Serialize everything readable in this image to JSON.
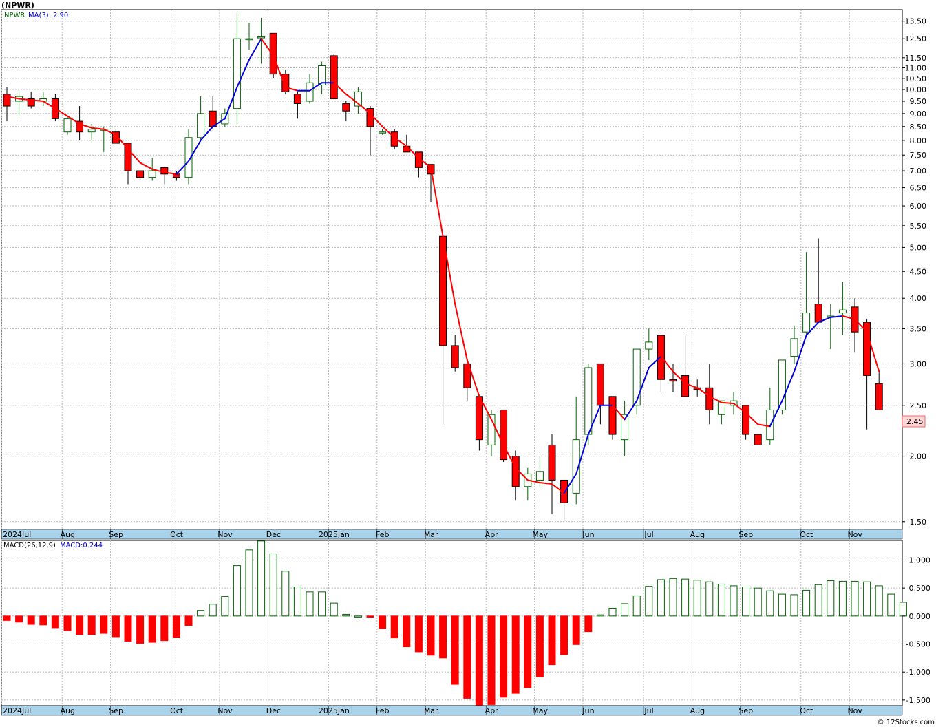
{
  "title": "(NPWR)",
  "footer": "© 12Stocks.com",
  "price_panel": {
    "legend_symbol": "NPWR",
    "legend_ma": "MA(3)",
    "legend_ma_value": "2.90",
    "last_price_label": "2.45"
  },
  "macd_panel": {
    "legend_params": "MACD(26,12,9)",
    "legend_value": "MACD:0.244"
  },
  "colors": {
    "up_candle": "#006400",
    "down_candle": "#ff0000",
    "ma_up": "#0000dd",
    "ma_down": "#ff0000",
    "grid": "#b8b8b8",
    "axis_band": "#a9d3ea"
  },
  "x_axis": {
    "labels": [
      {
        "label": "2024Jul",
        "week": 0
      },
      {
        "label": "Aug",
        "week": 5
      },
      {
        "label": "Sep",
        "week": 9
      },
      {
        "label": "Oct",
        "week": 14
      },
      {
        "label": "Nov",
        "week": 18
      },
      {
        "label": "Dec",
        "week": 22
      },
      {
        "label": "2025Jan",
        "week": 27
      },
      {
        "label": "Feb",
        "week": 31
      },
      {
        "label": "Mar",
        "week": 35
      },
      {
        "label": "Apr",
        "week": 40
      },
      {
        "label": "May",
        "week": 44
      },
      {
        "label": "Jun",
        "week": 48
      },
      {
        "label": "Jul",
        "week": 53
      },
      {
        "label": "Aug",
        "week": 57
      },
      {
        "label": "Sep",
        "week": 61
      },
      {
        "label": "Oct",
        "week": 66
      },
      {
        "label": "Nov",
        "week": 70
      }
    ]
  },
  "chart_data": [
    {
      "type": "candlestick",
      "title": "(NPWR)",
      "scale": "log",
      "ylim": [
        1.45,
        14.2
      ],
      "yticks": [
        "1.50",
        "2.00",
        "2.50",
        "3.00",
        "3.50",
        "4.00",
        "4.50",
        "5.00",
        "5.50",
        "6.00",
        "6.50",
        "7.00",
        "7.50",
        "8.00",
        "8.50",
        "9.00",
        "9.50",
        "10.00",
        "10.50",
        "11.00",
        "11.50",
        "12.50",
        "13.50"
      ],
      "candles": [
        {
          "o": 9.8,
          "h": 10.1,
          "l": 8.7,
          "c": 9.3
        },
        {
          "o": 9.5,
          "h": 9.9,
          "l": 8.9,
          "c": 9.7
        },
        {
          "o": 9.6,
          "h": 9.9,
          "l": 9.2,
          "c": 9.3
        },
        {
          "o": 9.5,
          "h": 9.9,
          "l": 9.3,
          "c": 9.6
        },
        {
          "o": 9.6,
          "h": 9.8,
          "l": 8.7,
          "c": 8.8
        },
        {
          "o": 8.3,
          "h": 8.9,
          "l": 8.2,
          "c": 8.8
        },
        {
          "o": 8.7,
          "h": 9.3,
          "l": 8.0,
          "c": 8.3
        },
        {
          "o": 8.3,
          "h": 8.6,
          "l": 8.0,
          "c": 8.4
        },
        {
          "o": 8.4,
          "h": 8.5,
          "l": 7.6,
          "c": 8.4
        },
        {
          "o": 8.3,
          "h": 8.4,
          "l": 7.9,
          "c": 7.9
        },
        {
          "o": 7.9,
          "h": 7.9,
          "l": 6.6,
          "c": 7.0
        },
        {
          "o": 7.0,
          "h": 7.0,
          "l": 6.7,
          "c": 6.8
        },
        {
          "o": 6.8,
          "h": 7.4,
          "l": 6.7,
          "c": 7.0
        },
        {
          "o": 7.1,
          "h": 7.1,
          "l": 6.6,
          "c": 6.9
        },
        {
          "o": 6.9,
          "h": 7.0,
          "l": 6.7,
          "c": 6.8
        },
        {
          "o": 6.8,
          "h": 8.4,
          "l": 6.6,
          "c": 8.1
        },
        {
          "o": 8.1,
          "h": 9.7,
          "l": 8.0,
          "c": 9.0
        },
        {
          "o": 9.1,
          "h": 9.7,
          "l": 8.4,
          "c": 8.5
        },
        {
          "o": 8.6,
          "h": 9.2,
          "l": 8.5,
          "c": 9.0
        },
        {
          "o": 9.2,
          "h": 14.0,
          "l": 8.6,
          "c": 12.5
        },
        {
          "o": 12.5,
          "h": 13.4,
          "l": 11.9,
          "c": 12.5
        },
        {
          "o": 12.6,
          "h": 13.7,
          "l": 11.2,
          "c": 12.6
        },
        {
          "o": 12.8,
          "h": 12.8,
          "l": 10.5,
          "c": 10.7
        },
        {
          "o": 10.7,
          "h": 10.9,
          "l": 9.8,
          "c": 9.9
        },
        {
          "o": 9.8,
          "h": 9.9,
          "l": 8.8,
          "c": 9.4
        },
        {
          "o": 9.5,
          "h": 10.7,
          "l": 9.4,
          "c": 10.3
        },
        {
          "o": 10.2,
          "h": 11.3,
          "l": 9.8,
          "c": 11.1
        },
        {
          "o": 11.6,
          "h": 11.7,
          "l": 9.6,
          "c": 9.6
        },
        {
          "o": 9.4,
          "h": 9.5,
          "l": 8.7,
          "c": 9.1
        },
        {
          "o": 9.3,
          "h": 10.1,
          "l": 9.0,
          "c": 9.9
        },
        {
          "o": 9.2,
          "h": 9.3,
          "l": 7.5,
          "c": 8.5
        },
        {
          "o": 8.3,
          "h": 8.4,
          "l": 8.2,
          "c": 8.3
        },
        {
          "o": 8.3,
          "h": 8.4,
          "l": 7.7,
          "c": 7.8
        },
        {
          "o": 7.8,
          "h": 8.2,
          "l": 7.6,
          "c": 7.6
        },
        {
          "o": 7.6,
          "h": 7.6,
          "l": 6.8,
          "c": 7.1
        },
        {
          "o": 7.2,
          "h": 7.2,
          "l": 6.1,
          "c": 6.9
        },
        {
          "o": 5.25,
          "h": 5.25,
          "l": 2.3,
          "c": 3.25
        },
        {
          "o": 3.25,
          "h": 3.4,
          "l": 2.9,
          "c": 2.95
        },
        {
          "o": 3.0,
          "h": 3.0,
          "l": 2.55,
          "c": 2.7
        },
        {
          "o": 2.6,
          "h": 2.6,
          "l": 2.05,
          "c": 2.15
        },
        {
          "o": 2.1,
          "h": 2.45,
          "l": 2.0,
          "c": 2.4
        },
        {
          "o": 2.45,
          "h": 2.45,
          "l": 1.95,
          "c": 1.97
        },
        {
          "o": 2.0,
          "h": 2.05,
          "l": 1.65,
          "c": 1.75
        },
        {
          "o": 1.75,
          "h": 1.9,
          "l": 1.65,
          "c": 1.85
        },
        {
          "o": 1.8,
          "h": 2.0,
          "l": 1.75,
          "c": 1.87
        },
        {
          "o": 2.1,
          "h": 2.2,
          "l": 1.55,
          "c": 1.8
        },
        {
          "o": 1.8,
          "h": 1.8,
          "l": 1.5,
          "c": 1.63
        },
        {
          "o": 1.7,
          "h": 2.6,
          "l": 1.62,
          "c": 2.15
        },
        {
          "o": 2.2,
          "h": 3.0,
          "l": 2.1,
          "c": 2.95
        },
        {
          "o": 3.0,
          "h": 3.0,
          "l": 2.3,
          "c": 2.5
        },
        {
          "o": 2.6,
          "h": 2.6,
          "l": 2.15,
          "c": 2.2
        },
        {
          "o": 2.15,
          "h": 2.55,
          "l": 2.0,
          "c": 2.4
        },
        {
          "o": 2.5,
          "h": 3.2,
          "l": 2.4,
          "c": 3.2
        },
        {
          "o": 3.2,
          "h": 3.5,
          "l": 3.05,
          "c": 3.3
        },
        {
          "o": 3.4,
          "h": 3.4,
          "l": 2.65,
          "c": 2.8
        },
        {
          "o": 2.8,
          "h": 3.0,
          "l": 2.65,
          "c": 2.78
        },
        {
          "o": 2.85,
          "h": 3.4,
          "l": 2.6,
          "c": 2.6
        },
        {
          "o": 2.7,
          "h": 2.8,
          "l": 2.6,
          "c": 2.68
        },
        {
          "o": 2.7,
          "h": 3.0,
          "l": 2.3,
          "c": 2.45
        },
        {
          "o": 2.4,
          "h": 2.55,
          "l": 2.3,
          "c": 2.55
        },
        {
          "o": 2.5,
          "h": 2.65,
          "l": 2.4,
          "c": 2.55
        },
        {
          "o": 2.5,
          "h": 2.5,
          "l": 2.15,
          "c": 2.2
        },
        {
          "o": 2.2,
          "h": 2.2,
          "l": 2.1,
          "c": 2.1
        },
        {
          "o": 2.15,
          "h": 2.7,
          "l": 2.1,
          "c": 2.45
        },
        {
          "o": 2.45,
          "h": 3.05,
          "l": 2.4,
          "c": 3.05
        },
        {
          "o": 3.1,
          "h": 3.55,
          "l": 3.0,
          "c": 3.35
        },
        {
          "o": 3.45,
          "h": 4.9,
          "l": 3.4,
          "c": 3.75
        },
        {
          "o": 3.9,
          "h": 5.2,
          "l": 3.6,
          "c": 3.6
        },
        {
          "o": 3.7,
          "h": 3.9,
          "l": 3.2,
          "c": 3.7
        },
        {
          "o": 3.75,
          "h": 4.3,
          "l": 3.4,
          "c": 3.8
        },
        {
          "o": 3.85,
          "h": 4.0,
          "l": 3.15,
          "c": 3.45
        },
        {
          "o": 3.6,
          "h": 3.65,
          "l": 2.25,
          "c": 2.85
        },
        {
          "o": 2.75,
          "h": 2.9,
          "l": 2.45,
          "c": 2.45
        }
      ],
      "ma": [
        9.7,
        9.6,
        9.55,
        9.5,
        9.2,
        8.9,
        8.6,
        8.45,
        8.4,
        8.2,
        7.7,
        7.25,
        7.05,
        6.95,
        6.9,
        7.3,
        8.0,
        8.5,
        8.8,
        10.1,
        11.4,
        12.5,
        11.6,
        10.1,
        9.95,
        9.95,
        10.3,
        10.3,
        9.8,
        9.4,
        9.0,
        8.5,
        8.1,
        7.8,
        7.4,
        7.1,
        5.25,
        3.9,
        3.05,
        2.6,
        2.35,
        2.1,
        1.9,
        1.8,
        1.78,
        1.77,
        1.7,
        1.85,
        2.2,
        2.5,
        2.5,
        2.35,
        2.55,
        2.95,
        3.1,
        2.9,
        2.75,
        2.7,
        2.6,
        2.53,
        2.52,
        2.42,
        2.3,
        2.28,
        2.55,
        2.9,
        3.4,
        3.6,
        3.68,
        3.7,
        3.65,
        3.45,
        2.9
      ]
    },
    {
      "type": "bar",
      "title": "MACD(26,12,9)",
      "ylim": [
        -1.6,
        1.35
      ],
      "yticks": [
        "1.000",
        "0.500",
        "0.000",
        "-0.500",
        "-1.000",
        "-1.500"
      ],
      "values": [
        -0.08,
        -0.11,
        -0.15,
        -0.16,
        -0.21,
        -0.26,
        -0.33,
        -0.33,
        -0.31,
        -0.37,
        -0.45,
        -0.49,
        -0.47,
        -0.44,
        -0.38,
        -0.17,
        0.1,
        0.21,
        0.35,
        0.9,
        1.18,
        1.34,
        1.11,
        0.8,
        0.52,
        0.43,
        0.43,
        0.23,
        0.03,
        0.0,
        -0.02,
        -0.22,
        -0.39,
        -0.55,
        -0.64,
        -0.7,
        -0.75,
        -1.22,
        -1.47,
        -1.6,
        -1.58,
        -1.45,
        -1.38,
        -1.28,
        -1.09,
        -0.87,
        -0.69,
        -0.51,
        -0.28,
        0.02,
        0.14,
        0.22,
        0.36,
        0.53,
        0.65,
        0.67,
        0.66,
        0.64,
        0.61,
        0.57,
        0.54,
        0.52,
        0.5,
        0.45,
        0.39,
        0.38,
        0.46,
        0.56,
        0.63,
        0.62,
        0.62,
        0.61,
        0.54,
        0.39,
        0.244
      ]
    }
  ]
}
